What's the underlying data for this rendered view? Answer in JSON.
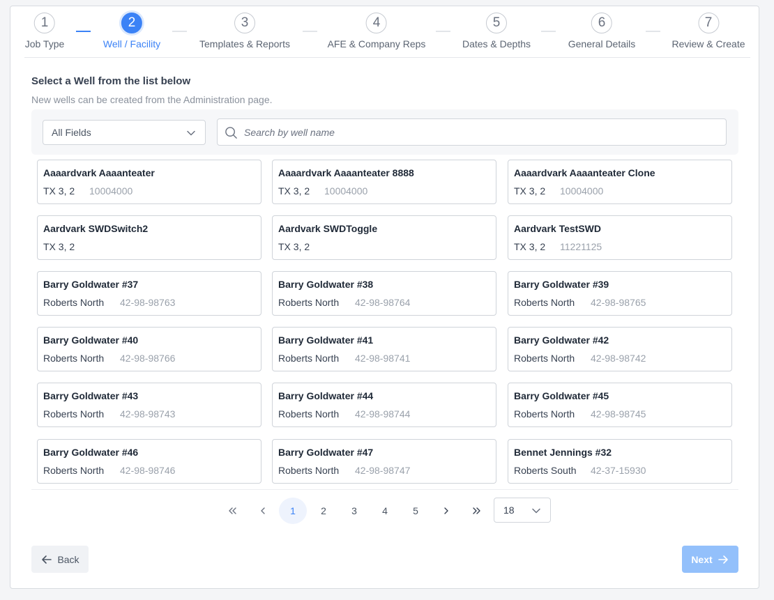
{
  "stepper": {
    "steps": [
      {
        "number": "1",
        "label": "Job Type"
      },
      {
        "number": "2",
        "label": "Well / Facility"
      },
      {
        "number": "3",
        "label": "Templates & Reports"
      },
      {
        "number": "4",
        "label": "AFE & Company Reps"
      },
      {
        "number": "5",
        "label": "Dates & Depths"
      },
      {
        "number": "6",
        "label": "General Details"
      },
      {
        "number": "7",
        "label": "Review & Create"
      }
    ],
    "active_step": 2
  },
  "content": {
    "title": "Select a Well from the list below",
    "subtitle": "New wells can be created from the Administration page."
  },
  "filter": {
    "field_select_value": "All Fields",
    "search_placeholder": "Search by well name",
    "search_value": ""
  },
  "wells": [
    {
      "name": "Aaaardvark Aaaanteater",
      "field": "TX 3, 2",
      "api": "10004000"
    },
    {
      "name": "Aaaardvark Aaaanteater 8888",
      "field": "TX 3, 2",
      "api": "10004000"
    },
    {
      "name": "Aaaardvark Aaaanteater Clone",
      "field": "TX 3, 2",
      "api": "10004000"
    },
    {
      "name": "Aardvark SWDSwitch2",
      "field": "TX 3, 2",
      "api": ""
    },
    {
      "name": "Aardvark SWDToggle",
      "field": "TX 3, 2",
      "api": ""
    },
    {
      "name": "Aardvark TestSWD",
      "field": "TX 3, 2",
      "api": "11221125"
    },
    {
      "name": "Barry Goldwater #37",
      "field": "Roberts North",
      "api": "42-98-98763"
    },
    {
      "name": "Barry Goldwater #38",
      "field": "Roberts North",
      "api": "42-98-98764"
    },
    {
      "name": "Barry Goldwater #39",
      "field": "Roberts North",
      "api": "42-98-98765"
    },
    {
      "name": "Barry Goldwater #40",
      "field": "Roberts North",
      "api": "42-98-98766"
    },
    {
      "name": "Barry Goldwater #41",
      "field": "Roberts North",
      "api": "42-98-98741"
    },
    {
      "name": "Barry Goldwater #42",
      "field": "Roberts North",
      "api": "42-98-98742"
    },
    {
      "name": "Barry Goldwater #43",
      "field": "Roberts North",
      "api": "42-98-98743"
    },
    {
      "name": "Barry Goldwater #44",
      "field": "Roberts North",
      "api": "42-98-98744"
    },
    {
      "name": "Barry Goldwater #45",
      "field": "Roberts North",
      "api": "42-98-98745"
    },
    {
      "name": "Barry Goldwater #46",
      "field": "Roberts North",
      "api": "42-98-98746"
    },
    {
      "name": "Barry Goldwater #47",
      "field": "Roberts North",
      "api": "42-98-98747"
    },
    {
      "name": "Bennet Jennings #32",
      "field": "Roberts South",
      "api": "42-37-15930"
    }
  ],
  "pagination": {
    "first_icon": "double-chevron-left-icon",
    "prev_icon": "chevron-left-icon",
    "next_icon": "chevron-right-icon",
    "last_icon": "double-chevron-right-icon",
    "pages": [
      "1",
      "2",
      "3",
      "4",
      "5"
    ],
    "current_page": "1",
    "page_size": "18"
  },
  "footer": {
    "back_label": "Back",
    "next_label": "Next"
  },
  "colors": {
    "accent": "#3b82f6",
    "next_disabled": "#93c0fb"
  }
}
